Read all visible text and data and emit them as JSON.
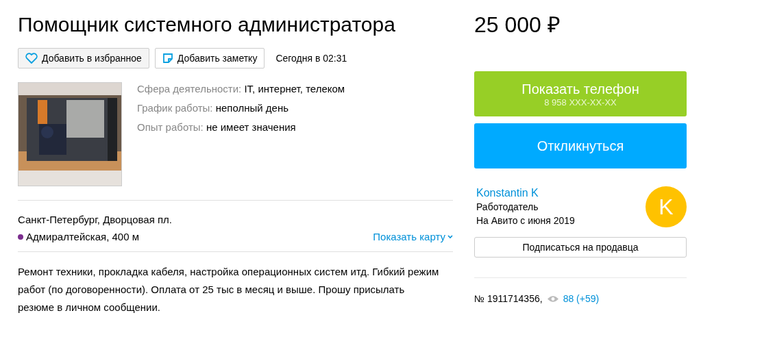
{
  "title": "Помощник системного администратора",
  "price": "25 000 ₽",
  "actions": [
    {
      "kind": "favorite",
      "label": "Добавить в избранное"
    },
    {
      "kind": "note",
      "label": "Добавить заметку"
    }
  ],
  "posted": "Сегодня в 02:31",
  "params": [
    {
      "label": "Сфера деятельности:",
      "value": "IT, интернет, телеком"
    },
    {
      "label": "График работы:",
      "value": "неполный день"
    },
    {
      "label": "Опыт работы:",
      "value": "не имеет значения"
    }
  ],
  "address": "Санкт-Петербург, Дворцовая пл.",
  "metro": {
    "name": "Адмиралтейская, 400 м",
    "color": "#7b2d8e"
  },
  "map_link": "Показать карту",
  "description": "Ремонт техники, прокладка кабеля, настройка операционных систем итд. Гибкий режим работ (по договоренности). Оплата от 25 тыс в месяц и выше. Прошу присылать резюме в личном сообщении.",
  "phone_button": {
    "label": "Показать телефон",
    "number": "8 958 XXX-XX-XX"
  },
  "respond_button": "Откликнуться",
  "seller": {
    "name": "Konstantin K",
    "role": "Работодатель",
    "since": "На Авито с июня 2019",
    "initial": "K"
  },
  "subscribe_button": "Подписаться на продавца",
  "item_number": "№ 1911714356,",
  "views": "88 (+59)"
}
